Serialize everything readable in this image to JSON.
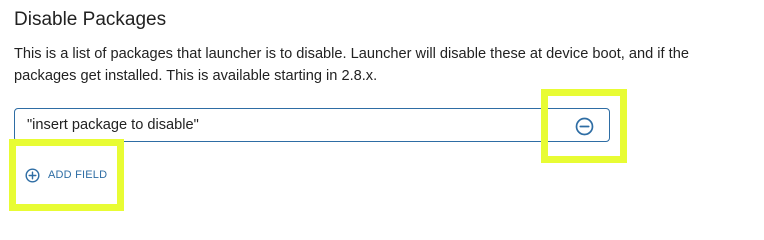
{
  "section": {
    "title": "Disable Packages",
    "description": "This is a list of packages that launcher is to disable. Launcher will disable these at device boot, and if the packages get installed. This is available starting in 2.8.x."
  },
  "fields": [
    {
      "value": "\"insert package to disable\"",
      "remove_icon": "minus-circle-icon"
    }
  ],
  "add_field": {
    "label": "ADD FIELD",
    "icon": "plus-circle-icon"
  },
  "colors": {
    "accent": "#2e6da4",
    "highlight": "#e8fc34",
    "text": "#222222"
  }
}
